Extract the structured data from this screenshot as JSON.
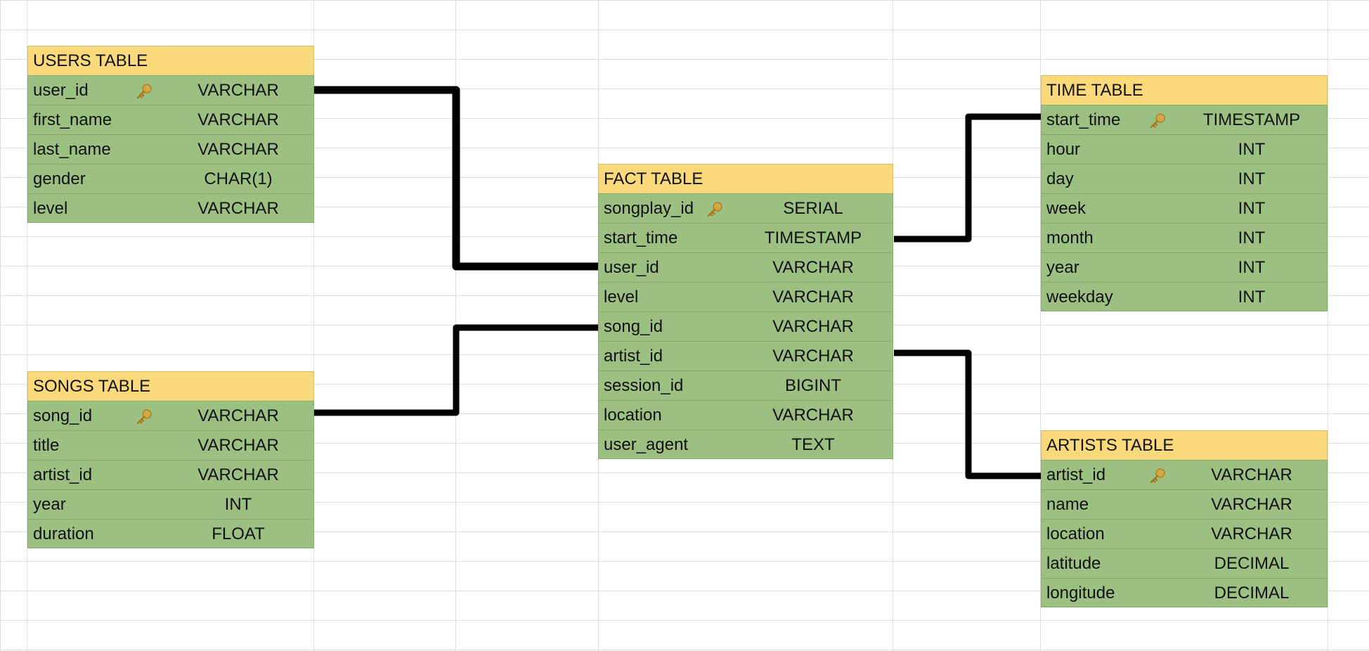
{
  "tables": {
    "users": {
      "title": "USERS TABLE",
      "rows": [
        {
          "name": "user_id",
          "type": "VARCHAR",
          "key": true
        },
        {
          "name": "first_name",
          "type": "VARCHAR",
          "key": false
        },
        {
          "name": "last_name",
          "type": "VARCHAR",
          "key": false
        },
        {
          "name": "gender",
          "type": "CHAR(1)",
          "key": false
        },
        {
          "name": "level",
          "type": "VARCHAR",
          "key": false
        }
      ]
    },
    "songs": {
      "title": "SONGS TABLE",
      "rows": [
        {
          "name": "song_id",
          "type": "VARCHAR",
          "key": true
        },
        {
          "name": "title",
          "type": "VARCHAR",
          "key": false
        },
        {
          "name": "artist_id",
          "type": "VARCHAR",
          "key": false
        },
        {
          "name": "year",
          "type": "INT",
          "key": false
        },
        {
          "name": "duration",
          "type": "FLOAT",
          "key": false
        }
      ]
    },
    "fact": {
      "title": "FACT TABLE",
      "rows": [
        {
          "name": "songplay_id",
          "type": "SERIAL",
          "key": true
        },
        {
          "name": "start_time",
          "type": "TIMESTAMP",
          "key": false
        },
        {
          "name": "user_id",
          "type": "VARCHAR",
          "key": false
        },
        {
          "name": "level",
          "type": "VARCHAR",
          "key": false
        },
        {
          "name": "song_id",
          "type": "VARCHAR",
          "key": false
        },
        {
          "name": "artist_id",
          "type": "VARCHAR",
          "key": false
        },
        {
          "name": "session_id",
          "type": "BIGINT",
          "key": false
        },
        {
          "name": "location",
          "type": "VARCHAR",
          "key": false
        },
        {
          "name": "user_agent",
          "type": "TEXT",
          "key": false
        }
      ]
    },
    "time": {
      "title": "TIME TABLE",
      "rows": [
        {
          "name": "start_time",
          "type": "TIMESTAMP",
          "key": true
        },
        {
          "name": "hour",
          "type": "INT",
          "key": false
        },
        {
          "name": "day",
          "type": "INT",
          "key": false
        },
        {
          "name": "week",
          "type": "INT",
          "key": false
        },
        {
          "name": "month",
          "type": "INT",
          "key": false
        },
        {
          "name": "year",
          "type": "INT",
          "key": false
        },
        {
          "name": "weekday",
          "type": "INT",
          "key": false
        }
      ]
    },
    "artists": {
      "title": "ARTISTS TABLE",
      "rows": [
        {
          "name": "artist_id",
          "type": "VARCHAR",
          "key": true
        },
        {
          "name": "name",
          "type": "VARCHAR",
          "key": false
        },
        {
          "name": "location",
          "type": "VARCHAR",
          "key": false
        },
        {
          "name": "latitude",
          "type": "DECIMAL",
          "key": false
        },
        {
          "name": "longitude",
          "type": "DECIMAL",
          "key": false
        }
      ]
    }
  },
  "key_icon": "key-icon",
  "colors": {
    "header": "#fad97b",
    "row": "#9cc082",
    "connector": "#000000"
  },
  "relations": [
    {
      "from": "users.user_id",
      "to": "fact.user_id"
    },
    {
      "from": "songs.song_id",
      "to": "fact.song_id"
    },
    {
      "from": "time.start_time",
      "to": "fact.start_time"
    },
    {
      "from": "artists.artist_id",
      "to": "fact.artist_id"
    }
  ]
}
